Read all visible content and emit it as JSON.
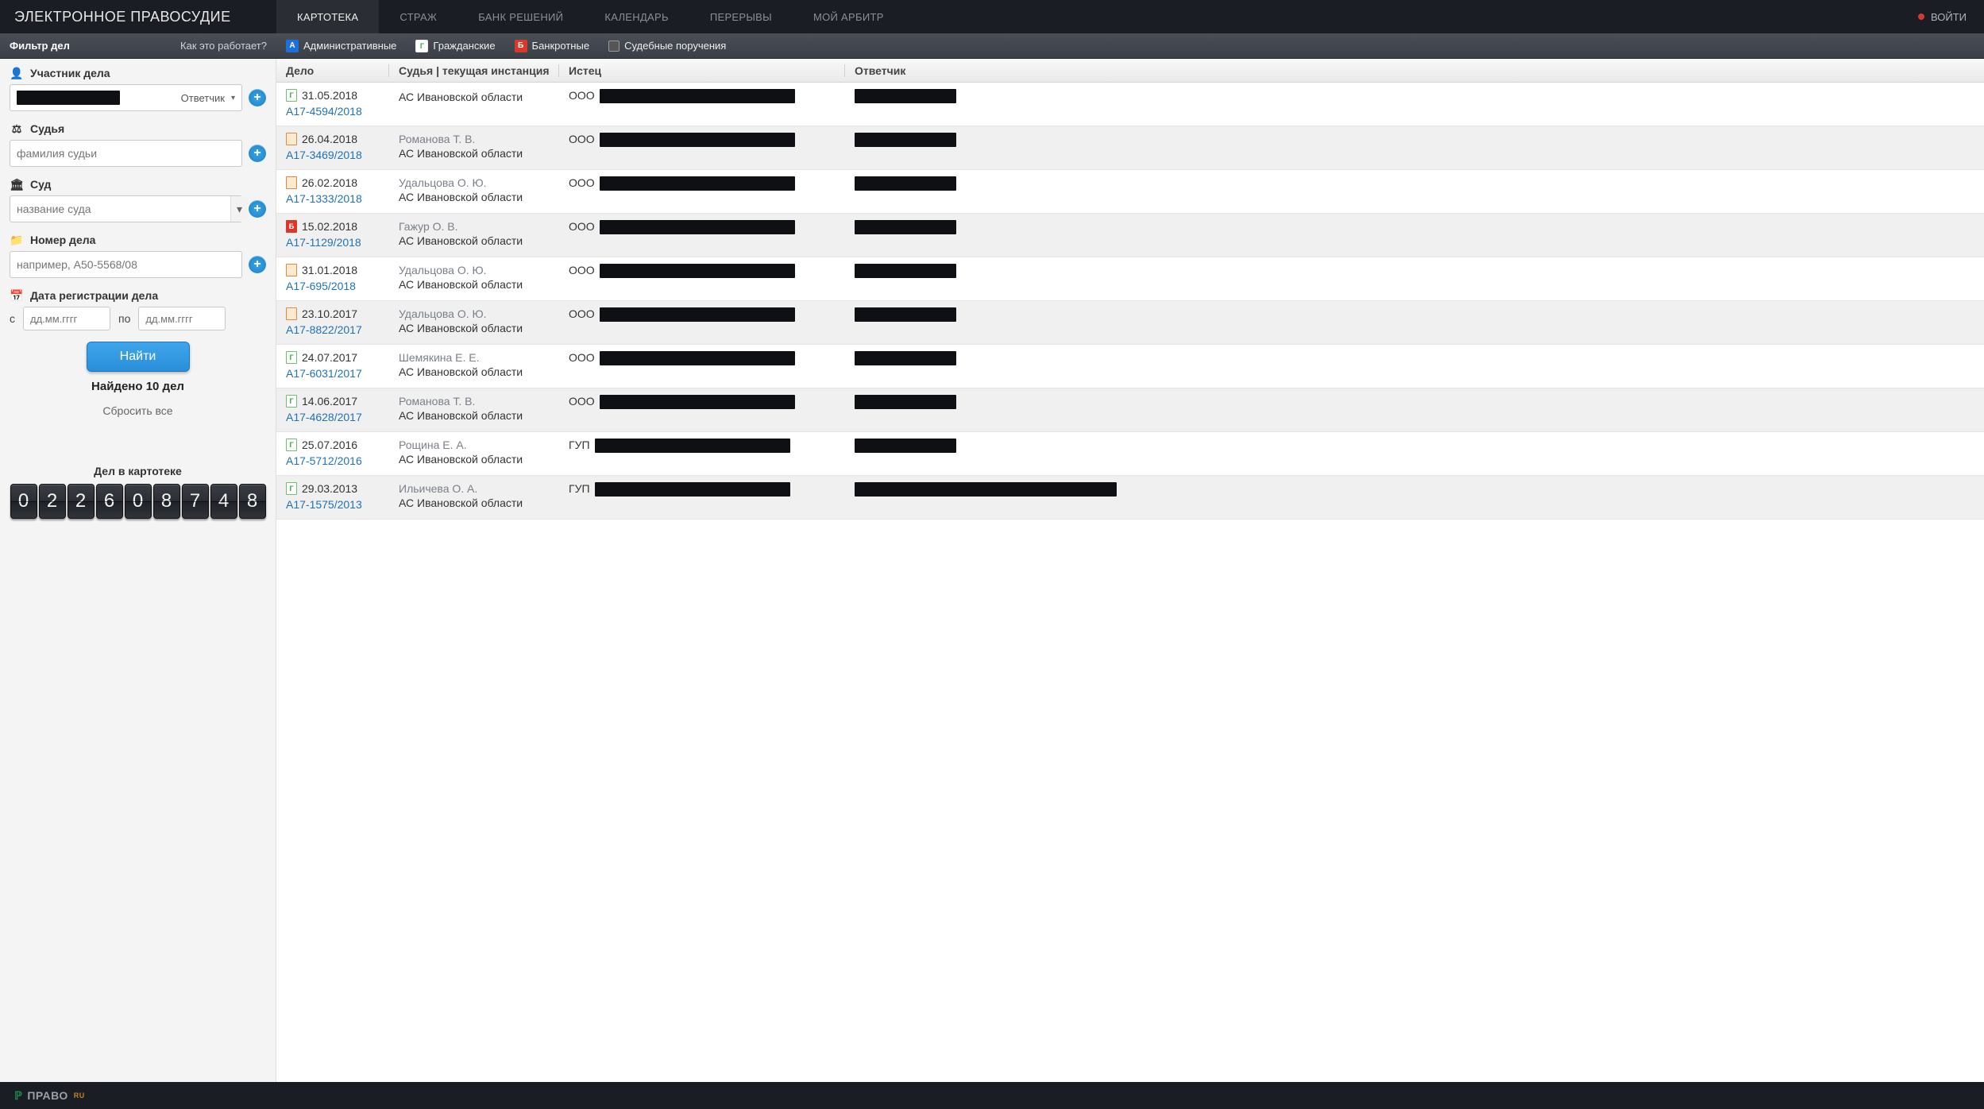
{
  "nav": {
    "logo": "ЭЛЕКТРОННОЕ ПРАВОСУДИЕ",
    "tabs": [
      {
        "label": "КАРТОТЕКА",
        "active": true
      },
      {
        "label": "СТРАЖ",
        "active": false
      },
      {
        "label": "БАНК РЕШЕНИЙ",
        "active": false
      },
      {
        "label": "КАЛЕНДАРЬ",
        "active": false
      },
      {
        "label": "ПЕРЕРЫВЫ",
        "active": false
      },
      {
        "label": "МОЙ АРБИТР",
        "active": false
      }
    ],
    "login": "ВОЙТИ"
  },
  "subbar": {
    "filter_title": "Фильтр дел",
    "help": "Как это работает?",
    "categories": [
      {
        "key": "adm",
        "letter": "А",
        "label": "Административные"
      },
      {
        "key": "civ",
        "letter": "Г",
        "label": "Гражданские"
      },
      {
        "key": "bank",
        "letter": "Б",
        "label": "Банкротные"
      },
      {
        "key": "assign",
        "letter": "",
        "label": "Судебные поручения"
      }
    ]
  },
  "filters": {
    "participant": {
      "label": "Участник дела",
      "role": "Ответчик"
    },
    "judge": {
      "label": "Судья",
      "placeholder": "фамилия судьи"
    },
    "court": {
      "label": "Суд",
      "placeholder": "название суда"
    },
    "casenum": {
      "label": "Номер дела",
      "placeholder": "например, А50-5568/08"
    },
    "date": {
      "label": "Дата регистрации дела",
      "from": "с",
      "to": "по",
      "placeholder": "дд.мм.гггг"
    },
    "search_btn": "Найти",
    "found": "Найдено 10 дел",
    "reset": "Сбросить все",
    "counter_title": "Дел в картотеке",
    "counter": "022608748"
  },
  "table": {
    "headers": {
      "case": "Дело",
      "judge": "Судья | текущая инстанция",
      "plaintiff": "Истец",
      "defendant": "Ответчик"
    },
    "rows": [
      {
        "icon": "g",
        "date": "31.05.2018",
        "case": "А17-4594/2018",
        "judge": "",
        "court": "АС Ивановской области",
        "plaintiff_prefix": "ООО"
      },
      {
        "icon": "b",
        "date": "26.04.2018",
        "case": "А17-3469/2018",
        "judge": "Романова Т. В.",
        "court": "АС Ивановской области",
        "plaintiff_prefix": "ООО"
      },
      {
        "icon": "b",
        "date": "26.02.2018",
        "case": "А17-1333/2018",
        "judge": "Удальцова О. Ю.",
        "court": "АС Ивановской области",
        "plaintiff_prefix": "ООО"
      },
      {
        "icon": "r",
        "date": "15.02.2018",
        "case": "А17-1129/2018",
        "judge": "Гажур О. В.",
        "court": "АС Ивановской области",
        "plaintiff_prefix": "ООО"
      },
      {
        "icon": "b",
        "date": "31.01.2018",
        "case": "А17-695/2018",
        "judge": "Удальцова О. Ю.",
        "court": "АС Ивановской области",
        "plaintiff_prefix": "ООО"
      },
      {
        "icon": "b",
        "date": "23.10.2017",
        "case": "А17-8822/2017",
        "judge": "Удальцова О. Ю.",
        "court": "АС Ивановской области",
        "plaintiff_prefix": "ООО"
      },
      {
        "icon": "g",
        "date": "24.07.2017",
        "case": "А17-6031/2017",
        "judge": "Шемякина Е. Е.",
        "court": "АС Ивановской области",
        "plaintiff_prefix": "ООО"
      },
      {
        "icon": "g",
        "date": "14.06.2017",
        "case": "А17-4628/2017",
        "judge": "Романова Т. В.",
        "court": "АС Ивановской области",
        "plaintiff_prefix": "ООО"
      },
      {
        "icon": "g",
        "date": "25.07.2016",
        "case": "А17-5712/2016",
        "judge": "Рощина Е. А.",
        "court": "АС Ивановской области",
        "plaintiff_prefix": "ГУП"
      },
      {
        "icon": "g",
        "date": "29.03.2013",
        "case": "А17-1575/2013",
        "judge": "Ильичева О. А.",
        "court": "АС Ивановской области",
        "plaintiff_prefix": "ГУП",
        "defendant_wide": true
      }
    ]
  },
  "footer": {
    "brand": "ПРАВО",
    "suffix": "RU"
  }
}
